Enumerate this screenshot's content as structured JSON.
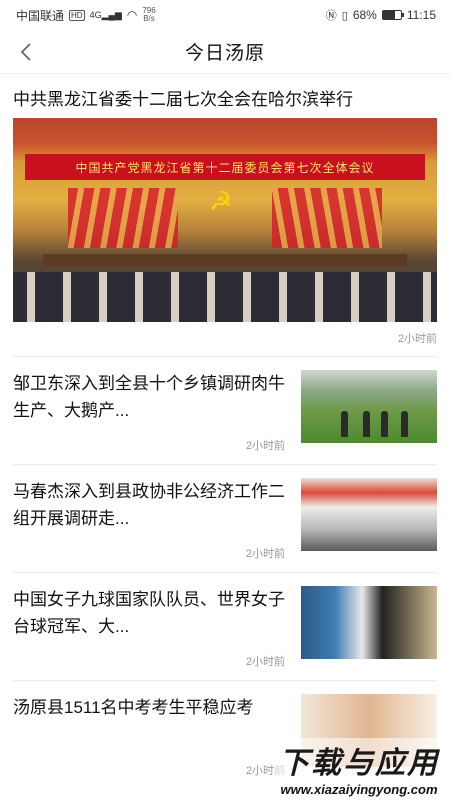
{
  "status_bar": {
    "carrier": "中国联通",
    "hd": "HD",
    "signal_type": "4G",
    "net_speed_value": "796",
    "net_speed_unit": "B/s",
    "battery": "68%",
    "battery_level": 0.68,
    "time": "11:15"
  },
  "nav": {
    "title": "今日汤原"
  },
  "lead": {
    "title": "中共黑龙江省委十二届七次全会在哈尔滨举行",
    "banner_text": "中国共产党黑龙江省第十二届委员会第七次全体会议",
    "time": "2小时前"
  },
  "news": [
    {
      "title": "邹卫东深入到全县十个乡镇调研肉牛生产、大鹅产...",
      "time": "2小时前"
    },
    {
      "title": "马春杰深入到县政协非公经济工作二组开展调研走...",
      "time": "2小时前"
    },
    {
      "title": "中国女子九球国家队队员、世界女子台球冠军、大...",
      "time": "2小时前"
    },
    {
      "title": "汤原县1511名中考考生平稳应考",
      "time": "2小时前"
    }
  ],
  "watermark": {
    "main": "下载与应用",
    "url": "www.xiazaiyingyong.com"
  }
}
